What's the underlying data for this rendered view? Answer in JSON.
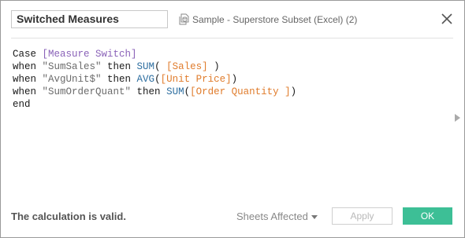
{
  "dialog": {
    "calc_name": "Switched Measures",
    "datasource_label": "Sample - Superstore Subset (Excel) (2)",
    "datasource_icon": "datasource-icon",
    "close_icon": "close-icon"
  },
  "formula": {
    "line1": {
      "kw": "Case ",
      "param": "[Measure Switch]"
    },
    "line2": {
      "kw1": "when ",
      "str": "\"SumSales\"",
      "kw2": " then ",
      "fn": "SUM",
      "open": "( ",
      "fld": "[Sales]",
      "close": " )"
    },
    "line3": {
      "kw1": "when ",
      "str": "\"AvgUnit$\"",
      "kw2": " then ",
      "fn": "AVG",
      "open": "(",
      "fld": "[Unit Price]",
      "close": ")"
    },
    "line4": {
      "kw1": "when ",
      "str": "\"SumOrderQuant\"",
      "kw2": " then ",
      "fn": "SUM",
      "open": "(",
      "fld": "[Order Quantity ]",
      "close": ")"
    },
    "line5": {
      "kw": "end"
    }
  },
  "footer": {
    "status": "The calculation is valid.",
    "sheets_affected": "Sheets Affected",
    "apply_label": "Apply",
    "ok_label": "OK"
  },
  "colors": {
    "ok_button": "#3dbf96",
    "parameter": "#8a62b8",
    "function": "#2d6ea0",
    "field": "#e07c2c"
  }
}
